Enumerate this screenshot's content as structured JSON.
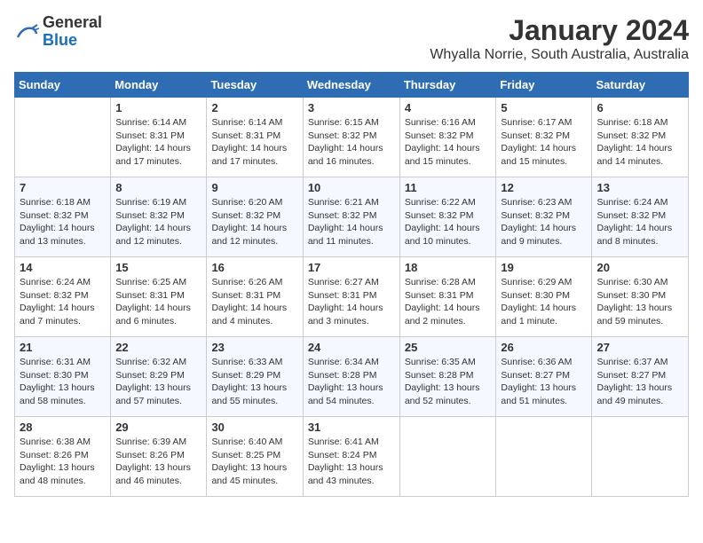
{
  "logo": {
    "general": "General",
    "blue": "Blue"
  },
  "title": "January 2024",
  "location": "Whyalla Norrie, South Australia, Australia",
  "headers": [
    "Sunday",
    "Monday",
    "Tuesday",
    "Wednesday",
    "Thursday",
    "Friday",
    "Saturday"
  ],
  "weeks": [
    [
      {
        "day": "",
        "sunrise": "",
        "sunset": "",
        "daylight": ""
      },
      {
        "day": "1",
        "sunrise": "Sunrise: 6:14 AM",
        "sunset": "Sunset: 8:31 PM",
        "daylight": "Daylight: 14 hours and 17 minutes."
      },
      {
        "day": "2",
        "sunrise": "Sunrise: 6:14 AM",
        "sunset": "Sunset: 8:31 PM",
        "daylight": "Daylight: 14 hours and 17 minutes."
      },
      {
        "day": "3",
        "sunrise": "Sunrise: 6:15 AM",
        "sunset": "Sunset: 8:32 PM",
        "daylight": "Daylight: 14 hours and 16 minutes."
      },
      {
        "day": "4",
        "sunrise": "Sunrise: 6:16 AM",
        "sunset": "Sunset: 8:32 PM",
        "daylight": "Daylight: 14 hours and 15 minutes."
      },
      {
        "day": "5",
        "sunrise": "Sunrise: 6:17 AM",
        "sunset": "Sunset: 8:32 PM",
        "daylight": "Daylight: 14 hours and 15 minutes."
      },
      {
        "day": "6",
        "sunrise": "Sunrise: 6:18 AM",
        "sunset": "Sunset: 8:32 PM",
        "daylight": "Daylight: 14 hours and 14 minutes."
      }
    ],
    [
      {
        "day": "7",
        "sunrise": "Sunrise: 6:18 AM",
        "sunset": "Sunset: 8:32 PM",
        "daylight": "Daylight: 14 hours and 13 minutes."
      },
      {
        "day": "8",
        "sunrise": "Sunrise: 6:19 AM",
        "sunset": "Sunset: 8:32 PM",
        "daylight": "Daylight: 14 hours and 12 minutes."
      },
      {
        "day": "9",
        "sunrise": "Sunrise: 6:20 AM",
        "sunset": "Sunset: 8:32 PM",
        "daylight": "Daylight: 14 hours and 12 minutes."
      },
      {
        "day": "10",
        "sunrise": "Sunrise: 6:21 AM",
        "sunset": "Sunset: 8:32 PM",
        "daylight": "Daylight: 14 hours and 11 minutes."
      },
      {
        "day": "11",
        "sunrise": "Sunrise: 6:22 AM",
        "sunset": "Sunset: 8:32 PM",
        "daylight": "Daylight: 14 hours and 10 minutes."
      },
      {
        "day": "12",
        "sunrise": "Sunrise: 6:23 AM",
        "sunset": "Sunset: 8:32 PM",
        "daylight": "Daylight: 14 hours and 9 minutes."
      },
      {
        "day": "13",
        "sunrise": "Sunrise: 6:24 AM",
        "sunset": "Sunset: 8:32 PM",
        "daylight": "Daylight: 14 hours and 8 minutes."
      }
    ],
    [
      {
        "day": "14",
        "sunrise": "Sunrise: 6:24 AM",
        "sunset": "Sunset: 8:32 PM",
        "daylight": "Daylight: 14 hours and 7 minutes."
      },
      {
        "day": "15",
        "sunrise": "Sunrise: 6:25 AM",
        "sunset": "Sunset: 8:31 PM",
        "daylight": "Daylight: 14 hours and 6 minutes."
      },
      {
        "day": "16",
        "sunrise": "Sunrise: 6:26 AM",
        "sunset": "Sunset: 8:31 PM",
        "daylight": "Daylight: 14 hours and 4 minutes."
      },
      {
        "day": "17",
        "sunrise": "Sunrise: 6:27 AM",
        "sunset": "Sunset: 8:31 PM",
        "daylight": "Daylight: 14 hours and 3 minutes."
      },
      {
        "day": "18",
        "sunrise": "Sunrise: 6:28 AM",
        "sunset": "Sunset: 8:31 PM",
        "daylight": "Daylight: 14 hours and 2 minutes."
      },
      {
        "day": "19",
        "sunrise": "Sunrise: 6:29 AM",
        "sunset": "Sunset: 8:30 PM",
        "daylight": "Daylight: 14 hours and 1 minute."
      },
      {
        "day": "20",
        "sunrise": "Sunrise: 6:30 AM",
        "sunset": "Sunset: 8:30 PM",
        "daylight": "Daylight: 13 hours and 59 minutes."
      }
    ],
    [
      {
        "day": "21",
        "sunrise": "Sunrise: 6:31 AM",
        "sunset": "Sunset: 8:30 PM",
        "daylight": "Daylight: 13 hours and 58 minutes."
      },
      {
        "day": "22",
        "sunrise": "Sunrise: 6:32 AM",
        "sunset": "Sunset: 8:29 PM",
        "daylight": "Daylight: 13 hours and 57 minutes."
      },
      {
        "day": "23",
        "sunrise": "Sunrise: 6:33 AM",
        "sunset": "Sunset: 8:29 PM",
        "daylight": "Daylight: 13 hours and 55 minutes."
      },
      {
        "day": "24",
        "sunrise": "Sunrise: 6:34 AM",
        "sunset": "Sunset: 8:28 PM",
        "daylight": "Daylight: 13 hours and 54 minutes."
      },
      {
        "day": "25",
        "sunrise": "Sunrise: 6:35 AM",
        "sunset": "Sunset: 8:28 PM",
        "daylight": "Daylight: 13 hours and 52 minutes."
      },
      {
        "day": "26",
        "sunrise": "Sunrise: 6:36 AM",
        "sunset": "Sunset: 8:27 PM",
        "daylight": "Daylight: 13 hours and 51 minutes."
      },
      {
        "day": "27",
        "sunrise": "Sunrise: 6:37 AM",
        "sunset": "Sunset: 8:27 PM",
        "daylight": "Daylight: 13 hours and 49 minutes."
      }
    ],
    [
      {
        "day": "28",
        "sunrise": "Sunrise: 6:38 AM",
        "sunset": "Sunset: 8:26 PM",
        "daylight": "Daylight: 13 hours and 48 minutes."
      },
      {
        "day": "29",
        "sunrise": "Sunrise: 6:39 AM",
        "sunset": "Sunset: 8:26 PM",
        "daylight": "Daylight: 13 hours and 46 minutes."
      },
      {
        "day": "30",
        "sunrise": "Sunrise: 6:40 AM",
        "sunset": "Sunset: 8:25 PM",
        "daylight": "Daylight: 13 hours and 45 minutes."
      },
      {
        "day": "31",
        "sunrise": "Sunrise: 6:41 AM",
        "sunset": "Sunset: 8:24 PM",
        "daylight": "Daylight: 13 hours and 43 minutes."
      },
      {
        "day": "",
        "sunrise": "",
        "sunset": "",
        "daylight": ""
      },
      {
        "day": "",
        "sunrise": "",
        "sunset": "",
        "daylight": ""
      },
      {
        "day": "",
        "sunrise": "",
        "sunset": "",
        "daylight": ""
      }
    ]
  ]
}
